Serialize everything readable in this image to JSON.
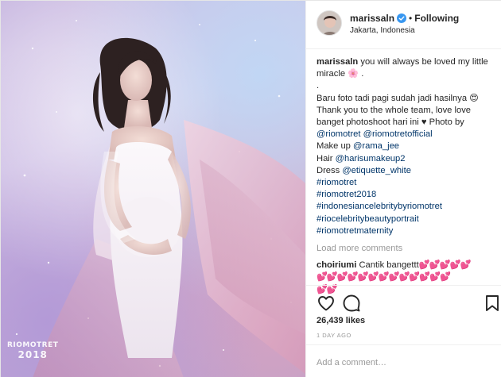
{
  "post": {
    "image_alt": "Pregnant woman in white dress with flowing pink tulle on a starry pastel background",
    "watermark": {
      "line1": "RIOMOTRET",
      "line2": "2018"
    }
  },
  "header": {
    "username": "marissaln",
    "separator": "•",
    "follow_label": "Following",
    "location": "Jakarta, Indonesia"
  },
  "caption": {
    "username": "marissaln",
    "lines": [
      "you will always be loved my little",
      "miracle 🌸 .",
      ".",
      "Baru foto tadi pagi sudah jadi hasilnya 😍",
      "Thank you to the whole team, love love",
      "banget photoshoot hari ini ♥ Photo by"
    ],
    "mentions_line": [
      "@riomotret",
      "@riomotretofficial"
    ],
    "makeup": {
      "label": "Make up ",
      "tag": "@rama_jee"
    },
    "hair": {
      "label": "Hair ",
      "tag": "@harisumakeup2"
    },
    "dress": {
      "label": "Dress ",
      "tag": "@etiquette_white"
    },
    "hashtags": [
      "#riomotret",
      "#riomotret2018",
      "#indonesiancelebritybyriomotret",
      "#riocelebritybeautyportrait",
      "#riomotretmaternity"
    ]
  },
  "load_more": "Load more comments",
  "comment": {
    "username": "choiriumi",
    "text": "Cantik bangettt",
    "hearts_line1": "💕💕💕💕💕",
    "hearts_line2": "💕💕💕💕💕💕💕💕💕💕💕💕💕",
    "hearts_line3": "💕💕"
  },
  "actions": {
    "likes": "26,439 likes",
    "time": "1 DAY AGO",
    "icons": [
      "heart-icon",
      "comment-icon",
      "bookmark-icon"
    ]
  },
  "add_comment": {
    "placeholder": "Add a comment…"
  },
  "colors": {
    "link": "#003569",
    "muted": "#999999",
    "verified": "#3897f0",
    "text": "#262626"
  }
}
